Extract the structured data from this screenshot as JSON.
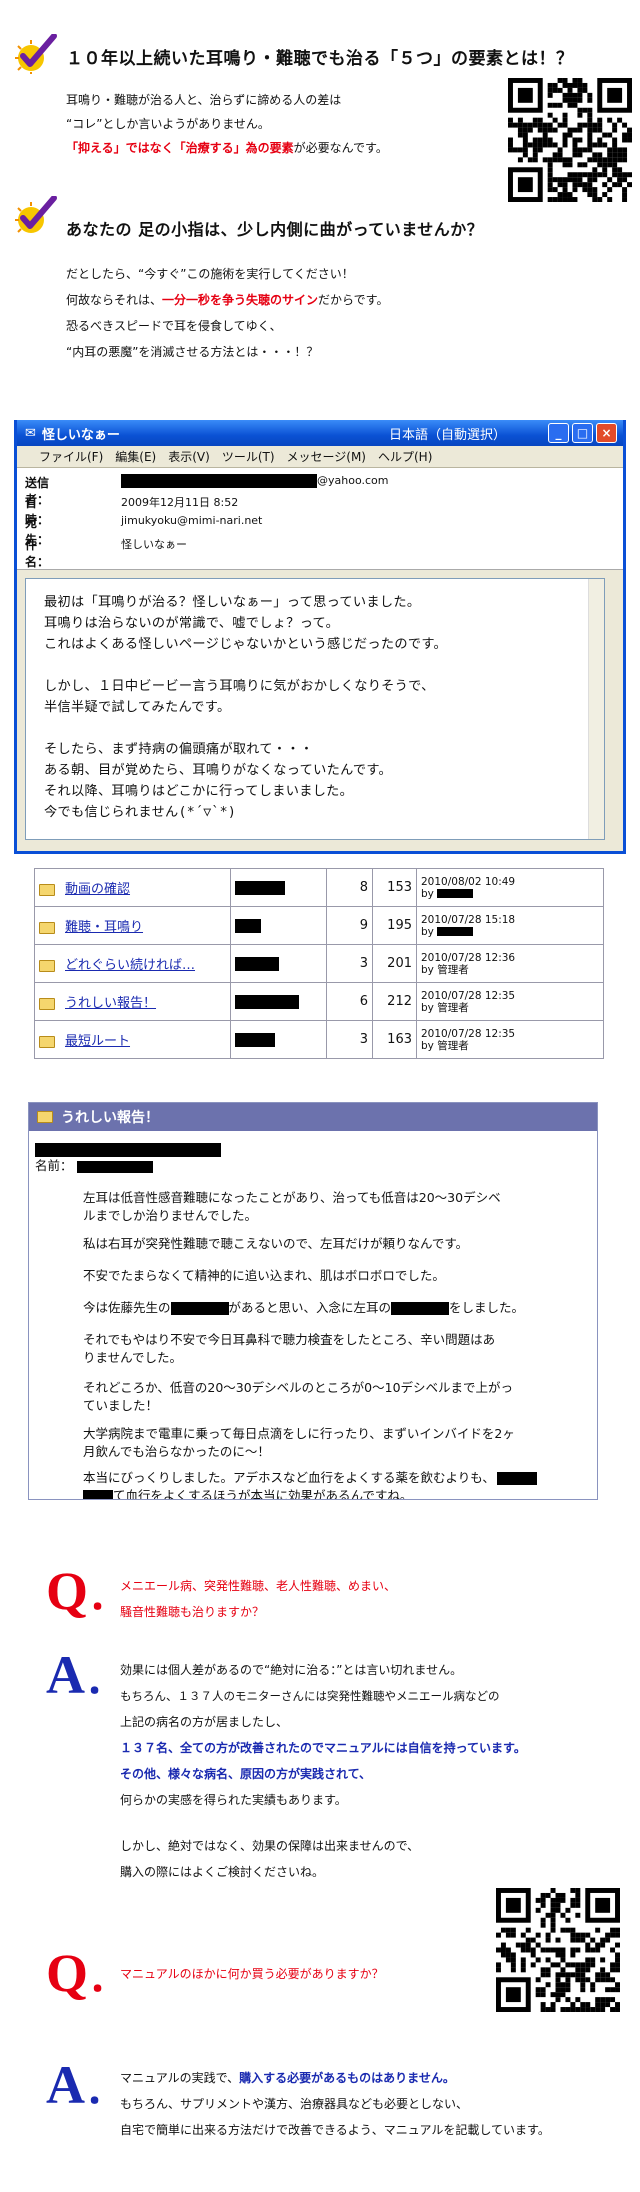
{
  "section1": {
    "heading": "１０年以上続いた耳鳴り・難聴でも治る「５つ」の要素とは！？",
    "line1": "耳鳴り・難聴が治る人と、治らずに諦める人の差は",
    "line2": "“コレ”としか言いようがありません。",
    "line3_red": "「抑える」ではなく「治療する」為の要素",
    "line3_rest": "が必要なんです。"
  },
  "section2": {
    "heading": "あなたの 足の小指は、少し内側に曲がっていませんか？",
    "line1": "だとしたら、“今すぐ”この施術を実行してください！",
    "line2_pre": "何故ならそれは、",
    "line2_red": "一分一秒を争う失聴のサイン",
    "line2_post": "だからです。",
    "line3": "恐るべきスピードで耳を侵食してゆく、",
    "line4": "“内耳の悪魔”を消滅させる方法とは・・・！？"
  },
  "email": {
    "window_title": "怪しいなぁー",
    "encoding_label": "日本語（自動選択）",
    "menu": [
      "ファイル(F)",
      "編集(E)",
      "表示(V)",
      "ツール(T)",
      "メッセージ(M)",
      "ヘルプ(H)"
    ],
    "from_label": "送信者：",
    "from_domain": "@yahoo.com",
    "date_label": "日時：",
    "date_value": "2009年12月11日 8:52",
    "to_label": "宛先：",
    "to_value": "jimukyoku@mimi-nari.net",
    "subject_label": "件名：",
    "subject_value": "怪しいなぁー",
    "body": [
      "最初は「耳鳴りが治る？怪しいなぁー」って思っていました。",
      "耳鳴りは治らないのが常識で、嘘でしょ？って。",
      "これはよくある怪しいページじゃないかという感じだったのです。",
      "",
      "しかし、１日中ビービー言う耳鳴りに気がおかしくなりそうで、",
      "半信半疑で試してみたんです。",
      "",
      "そしたら、まず持病の偏頭痛が取れて・・・",
      "ある朝、目が覚めたら、耳鳴りがなくなっていたんです。",
      "それ以降、耳鳴りはどこかに行ってしまいました。",
      "今でも信じられません(*´▽`*)"
    ]
  },
  "threads": [
    {
      "title": "動画の確認",
      "replies": "8",
      "views": "153",
      "date": "2010/08/02 10:49",
      "by": "by"
    },
    {
      "title": "難聴・耳鳴り",
      "replies": "9",
      "views": "195",
      "date": "2010/07/28 15:18",
      "by": "by"
    },
    {
      "title": "どれぐらい続ければ…",
      "replies": "3",
      "views": "201",
      "date": "2010/07/28 12:36",
      "by": "by 管理者"
    },
    {
      "title": "うれしい報告！",
      "replies": "6",
      "views": "212",
      "date": "2010/07/28 12:35",
      "by": "by 管理者"
    },
    {
      "title": "最短ルート",
      "replies": "3",
      "views": "163",
      "date": "2010/07/28 12:35",
      "by": "by 管理者"
    }
  ],
  "post": {
    "header": "うれしい報告！",
    "name_label": "名前：",
    "p1a": "左耳は低音性感音難聴になったことがあり、治っても低音は20～30デシベ",
    "p1b": "ルまでしか治りませんでした。",
    "p2": "私は右耳が突発性難聴で聴こえないので、左耳だけが頼りなんです。",
    "p3": "不安でたまらなくて精神的に追い込まれ、肌はボロボロでした。",
    "p4_pre": "今は佐藤先生の",
    "p4_mid": "があると思い、入念に左耳の",
    "p4_post": "をしました。",
    "p5a": "それでもやはり不安で今日耳鼻科で聴力検査をしたところ、辛い問題はあ",
    "p5b": "りませんでした。",
    "p6a": "それどころか、低音の20～30デシベルのところが0～10デシベルまで上がっ",
    "p6b": "ていました！",
    "p7a": "大学病院まで電車に乗って毎日点滴をしに行ったり、まずいインバイドを2ヶ",
    "p7b": "月飲んでも治らなかったのに～！",
    "p8a": "本当にびっくりしました。アデホスなど血行をよくする薬を飲むよりも、",
    "p8b": "て血行をよくするほうが本当に効果があるんですね。"
  },
  "qa": {
    "q_letter": "Q",
    "a_letter": "A",
    "dot": "．",
    "q1_line1": "メニエール病、突発性難聴、老人性難聴、めまい、",
    "q1_line2": "騒音性難聴も治りますか？",
    "a1_l1": "効果には個人差があるので“絶対に治る：”とは言い切れません。",
    "a1_l2": "もちろん、１３７人のモニターさんには突発性難聴やメニエール病などの",
    "a1_l3": "上記の病名の方が居ましたし、",
    "a1_l4": "１３７名、全ての方が改善されたのでマニュアルには自信を持っています。",
    "a1_l5": "その他、様々な病名、原因の方が実践されて、",
    "a1_l6": "何らかの実感を得られた実績もあります。",
    "a1_l7": "しかし、絶対ではなく、効果の保障は出来ませんので、",
    "a1_l8": "購入の際にはよくご検討くださいね。",
    "q2": "マニュアルのほかに何か買う必要がありますか？",
    "a2_l1_pre": "マニュアルの実践で、",
    "a2_l1_blue": "購入する必要があるものはありません。",
    "a2_l2": "もちろん、サプリメントや漢方、治療器具なども必要としない、",
    "a2_l3": "自宅で簡単に出来る方法だけで改善できるよう、マニュアルを記載しています。"
  }
}
